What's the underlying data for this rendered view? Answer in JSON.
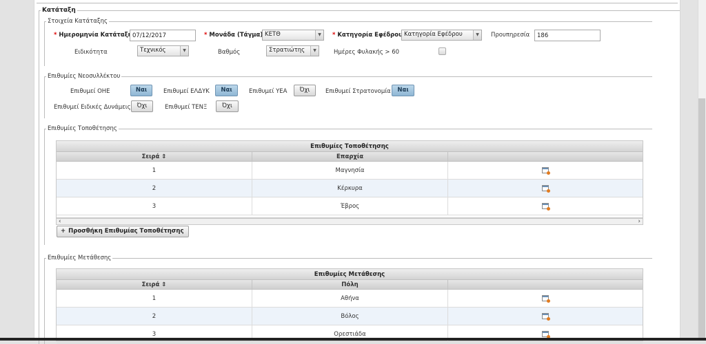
{
  "outer": {
    "legend": "Κατάταξη"
  },
  "details": {
    "legend": "Στοιχεία Κατάταξης",
    "date_label": "Ημερομηνία Κατάταξης",
    "date_value": "07/12/2017",
    "unit_label": "Μονάδα (Τάγμα)",
    "unit_value": "ΚΕΤΘ",
    "category_label": "Κατηγορία Εφέδρου",
    "category_value": "Κατηγορία Εφέδρου",
    "seniority_label": "Προυπηρεσία",
    "seniority_value": "186",
    "specialty_label": "Ειδικότητα",
    "specialty_value": "Τεχνικός",
    "rank_label": "Βαθμός",
    "rank_value": "Στρατιώτης",
    "custody_label": "Ημέρες Φυλακής > 60"
  },
  "prefs": {
    "legend": "Επιθυμίες Νεοσυλλέκτου",
    "items": [
      {
        "label": "Επιθυμεί ΟΗΕ",
        "value": "Ναι",
        "on": true
      },
      {
        "label": "Επιθυμεί ΕΛΔΥΚ",
        "value": "Ναι",
        "on": true
      },
      {
        "label": "Επιθυμεί ΥΕΑ",
        "value": "Όχι",
        "on": false
      },
      {
        "label": "Επιθυμεί Στρατονομία",
        "value": "Ναι",
        "on": true
      },
      {
        "label": "Επιθυμεί Ειδικές Δυνάμεις",
        "value": "Όχι",
        "on": false
      },
      {
        "label": "Επιθυμεί ΤΕΝΞ",
        "value": "Όχι",
        "on": false
      }
    ]
  },
  "placement": {
    "legend": "Επιθυμίες Τοποθέτησης",
    "caption": "Επιθυμίες Τοποθέτησης",
    "col1": "Σειρά ⇕",
    "col2": "Επαρχία",
    "rows": [
      {
        "order": "1",
        "name": "Μαγνησία"
      },
      {
        "order": "2",
        "name": "Κέρκυρα"
      },
      {
        "order": "3",
        "name": "Έβρος"
      }
    ],
    "add_label": "Προσθήκη Επιθυμίας Τοποθέτησης",
    "scroll_left": "‹",
    "scroll_right": "›"
  },
  "transfer": {
    "legend": "Επιθυμίες Μετάθεσης",
    "caption": "Επιθυμίες Μετάθεσης",
    "col1": "Σειρά ⇕",
    "col2": "Πόλη",
    "rows": [
      {
        "order": "1",
        "name": "Αθήνα"
      },
      {
        "order": "2",
        "name": "Βόλος"
      },
      {
        "order": "3",
        "name": "Ορεστιάδα"
      }
    ]
  },
  "icons": {
    "dropdown": "▼",
    "edit": "edit-icon",
    "add": "+"
  }
}
